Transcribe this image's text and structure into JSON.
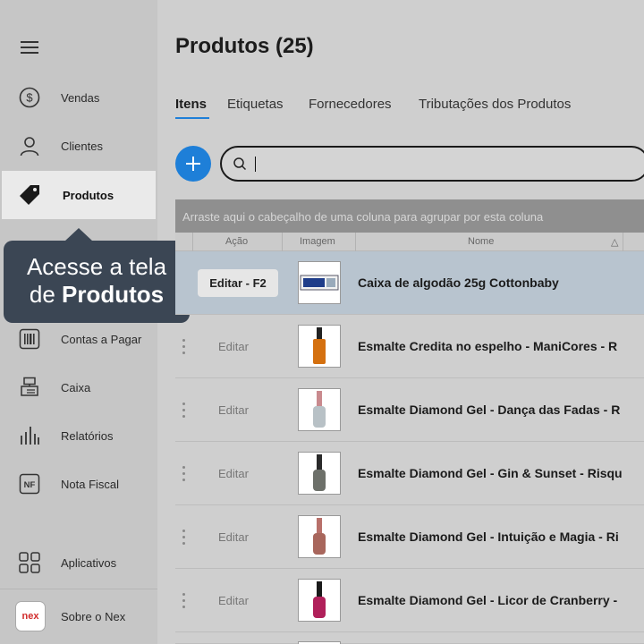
{
  "sidebar": {
    "items": [
      {
        "label": "Vendas",
        "icon": "dollar-icon"
      },
      {
        "label": "Clientes",
        "icon": "user-icon"
      },
      {
        "label": "Produtos",
        "icon": "tag-icon"
      },
      {
        "label": "Contas a Pagar",
        "icon": "barcode-icon"
      },
      {
        "label": "Caixa",
        "icon": "cash-register-icon"
      },
      {
        "label": "Relatórios",
        "icon": "bar-chart-icon"
      },
      {
        "label": "Nota Fiscal",
        "icon": "nf-icon",
        "icon_text": "NF"
      },
      {
        "label": "Aplicativos",
        "icon": "apps-grid-icon"
      },
      {
        "label": "Sobre o Nex",
        "icon": "nex-logo",
        "logo_text": "nex"
      }
    ]
  },
  "tooltip": {
    "line1": "Acesse a tela",
    "line2_prefix": "de ",
    "line2_bold": "Produtos"
  },
  "page": {
    "title": "Produtos (25)"
  },
  "tabs": [
    "Itens",
    "Etiquetas",
    "Fornecedores",
    "Tributações dos Produtos"
  ],
  "search": {
    "value": "",
    "placeholder": ""
  },
  "grid": {
    "group_hint": "Arraste aqui o cabeçalho de uma coluna para agrupar por esta coluna",
    "columns": [
      "Ação",
      "Imagem",
      "Nome"
    ],
    "sort_indicator": "△",
    "rows": [
      {
        "action": "Editar - F2",
        "name": "Caixa de algodão 25g Cottonbaby",
        "selected": true
      },
      {
        "action": "Editar",
        "name": "Esmalte Credita no espelho - ManiCores - R"
      },
      {
        "action": "Editar",
        "name": "Esmalte Diamond Gel - Dança das Fadas - R"
      },
      {
        "action": "Editar",
        "name": "Esmalte Diamond Gel - Gin & Sunset - Risqu"
      },
      {
        "action": "Editar",
        "name": "Esmalte Diamond Gel - Intuição e Magia - Ri"
      },
      {
        "action": "Editar",
        "name": "Esmalte Diamond Gel - Licor de Cranberry -"
      }
    ]
  },
  "colors": {
    "accent": "#1e7fd8",
    "tooltip_bg": "#3b4654",
    "selected_row": "#b8c4cf"
  }
}
